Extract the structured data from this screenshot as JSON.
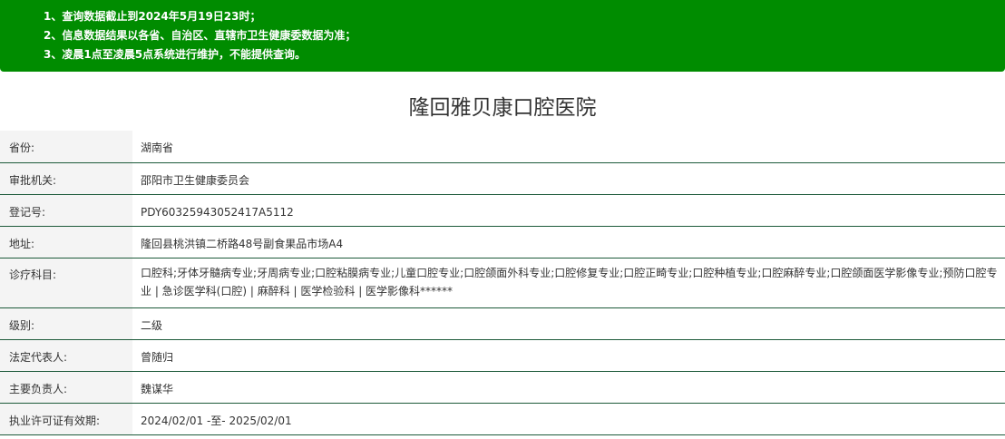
{
  "notice": {
    "items": [
      "1、查询数据截止到2024年5月19日23时；",
      "2、信息数据结果以各省、自治区、直辖市卫生健康委数据为准；",
      "3、凌晨1点至凌晨5点系统进行维护，不能提供查询。"
    ],
    "background_color": "#008c00"
  },
  "hospital": {
    "name": "隆回雅贝康口腔医院"
  },
  "fields": [
    {
      "label": "省份:",
      "value": "湖南省"
    },
    {
      "label": "审批机关:",
      "value": "邵阳市卫生健康委员会"
    },
    {
      "label": "登记号:",
      "value": "PDY60325943052417A5112"
    },
    {
      "label": "地址:",
      "value": "隆回县桃洪镇二桥路48号副食果品市场A4"
    },
    {
      "label": "诊疗科目:",
      "value": "口腔科;牙体牙髓病专业;牙周病专业;口腔粘膜病专业;儿童口腔专业;口腔颌面外科专业;口腔修复专业;口腔正畸专业;口腔种植专业;口腔麻醉专业;口腔颌面医学影像专业;预防口腔专业 | 急诊医学科(口腔) | 麻醉科 | 医学检验科 | 医学影像科******"
    },
    {
      "label": "级别:",
      "value": "二级"
    },
    {
      "label": "法定代表人:",
      "value": "曾随归"
    },
    {
      "label": "主要负责人:",
      "value": "魏谋华"
    },
    {
      "label": "执业许可证有效期:",
      "value": "2024/02/01 -至- 2025/02/01"
    }
  ]
}
